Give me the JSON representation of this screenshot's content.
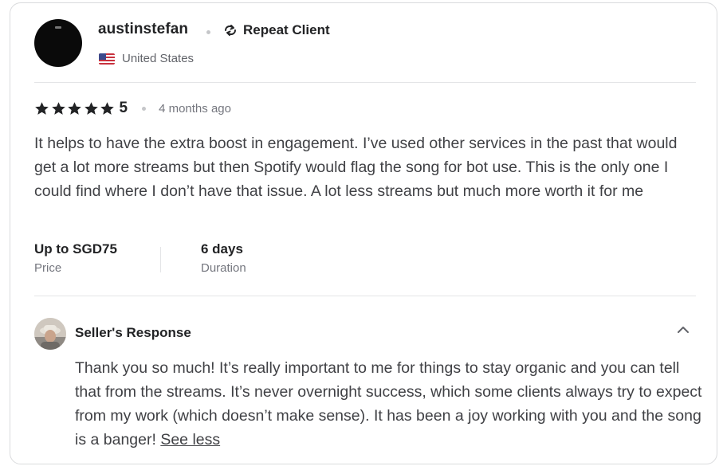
{
  "review": {
    "username": "austinstefan",
    "badge": {
      "label": "Repeat Client",
      "icon": "repeat-icon"
    },
    "country": "United States",
    "flag_icon": "us-flag-icon",
    "rating": "5",
    "rating_value": 5,
    "rating_max": 5,
    "time_ago": "4 months ago",
    "text": "It helps to have the extra boost in engagement. I’ve used other services in the past that would get a lot more streams but then Spotify would flag the song for bot use. This is the only one I could find where I don’t have that issue. A lot less streams but much more worth it for me",
    "price": {
      "value": "Up to SGD75",
      "label": "Price"
    },
    "duration": {
      "value": "6 days",
      "label": "Duration"
    }
  },
  "seller_response": {
    "title": "Seller's Response",
    "text": "Thank you so much! It’s really important to me for things to stay organic and you can tell that from the streams. It’s never overnight success, which some clients always try to expect from my work (which doesn’t make sense). It has been a joy working with you and the song is a banger!",
    "toggle_label": "See less",
    "collapse_icon": "chevron-up-icon"
  },
  "colors": {
    "text_primary": "#222325",
    "text_body": "#404145",
    "text_muted": "#74767e",
    "divider": "#e4e5e7",
    "border": "#dadbdd"
  }
}
